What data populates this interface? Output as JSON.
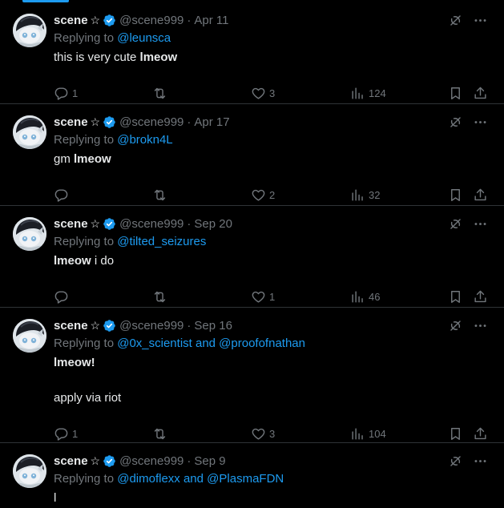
{
  "tweets": [
    {
      "name": "scene",
      "star": "☆",
      "handle": "@scene999",
      "date": "Apr 11",
      "reply_prefix": "Replying to ",
      "reply_to": "@leunsca",
      "body_lines": [
        {
          "text": "this is very cute ",
          "bold": "lmeow"
        }
      ],
      "replies": "1",
      "retweets": "",
      "likes": "3",
      "views": "124"
    },
    {
      "name": "scene",
      "star": "☆",
      "handle": "@scene999",
      "date": "Apr 17",
      "reply_prefix": "Replying to ",
      "reply_to": "@brokn4L",
      "body_lines": [
        {
          "text": "gm ",
          "bold": "lmeow"
        }
      ],
      "replies": "",
      "retweets": "",
      "likes": "2",
      "views": "32"
    },
    {
      "name": "scene",
      "star": "☆",
      "handle": "@scene999",
      "date": "Sep 20",
      "reply_prefix": "Replying to ",
      "reply_to": "@tilted_seizures",
      "body_lines": [
        {
          "bold_first": "lmeow",
          "text": " i do"
        }
      ],
      "replies": "",
      "retweets": "",
      "likes": "1",
      "views": "46"
    },
    {
      "name": "scene",
      "star": "☆",
      "handle": "@scene999",
      "date": "Sep 16",
      "reply_prefix": "Replying to ",
      "reply_to": "@0x_scientist and @proofofnathan",
      "body_lines": [
        {
          "bold_first": "lmeow!",
          "text": ""
        },
        {
          "text": ""
        },
        {
          "text": "apply via riot"
        }
      ],
      "replies": "1",
      "retweets": "",
      "likes": "3",
      "views": "104"
    },
    {
      "name": "scene",
      "star": "☆",
      "handle": "@scene999",
      "date": "Sep 9",
      "reply_prefix": "Replying to ",
      "reply_to": "@dimoflexx and @PlasmaFDN",
      "body_lines": [
        {
          "text": "l"
        }
      ],
      "replies": "",
      "retweets": "",
      "likes": "",
      "views": ""
    }
  ],
  "colors": {
    "background": "#000000",
    "text": "#e7e9ea",
    "muted": "#71767b",
    "accent": "#1d9bf0",
    "separator": "#2f3336"
  },
  "icons": [
    "verified-badge-icon",
    "grok-icon",
    "more-icon",
    "reply-icon",
    "retweet-icon",
    "like-icon",
    "views-icon",
    "bookmark-icon",
    "share-icon"
  ]
}
